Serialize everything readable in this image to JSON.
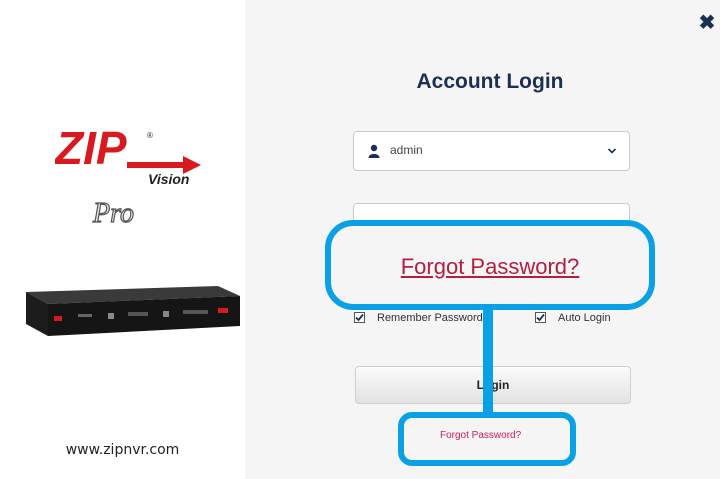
{
  "brand": {
    "logo_text": "ZIP",
    "logo_sub": "Vision",
    "logo_pro": "Pro",
    "website": "www.zipnvr.com"
  },
  "dialog": {
    "title": "Account Login",
    "username": {
      "value": "admin",
      "icon": "user-icon"
    },
    "password": {
      "value": ""
    },
    "remember_password": {
      "label": "Remember Password",
      "checked": true
    },
    "auto_login": {
      "label": "Auto Login",
      "checked": true
    },
    "login_label": "Login",
    "forgot_link": "Forgot Password?",
    "close_icon": "close-icon"
  },
  "callout": {
    "text": "Forgot Password?",
    "color": "#0aa0e6"
  }
}
